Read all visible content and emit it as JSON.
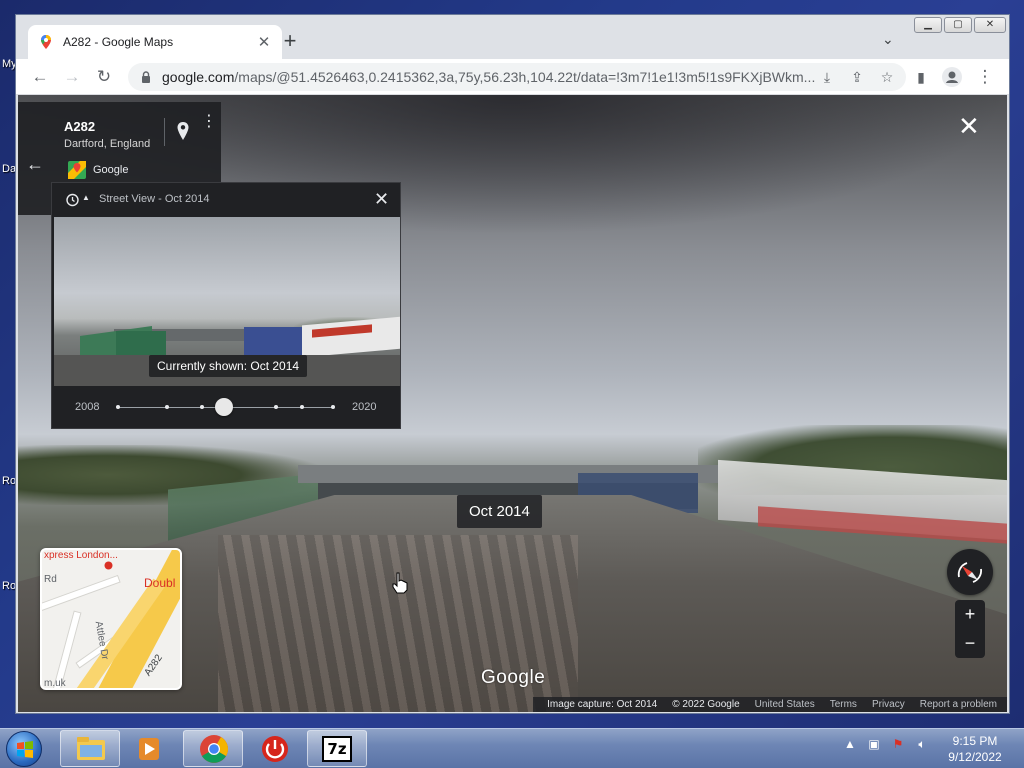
{
  "desktop": {
    "labels": [
      "My",
      "Da",
      "Ro",
      "Ro"
    ]
  },
  "browser": {
    "tab_title": "A282 - Google Maps",
    "new_tab_symbol": "+",
    "url_main": "google.com",
    "url_rest": "/maps/@51.4526463,0.2415362,3a,75y,56.23h,104.22t/data=!3m7!1e1!3m5!1s9FKXjBWkm..."
  },
  "place_card": {
    "road": "A282",
    "locality": "Dartford, England",
    "provider": "Google"
  },
  "time_machine": {
    "header": "Street View - Oct 2014",
    "tooltip": "Currently shown: Oct 2014",
    "year_start": "2008",
    "year_end": "2020"
  },
  "viewer": {
    "date_badge": "Oct 2014",
    "watermark": "Google",
    "zoom_in": "+",
    "zoom_out": "−"
  },
  "minimap": {
    "label_top": "xpress London...",
    "label_red": "Doubl",
    "label_rd": "Rd",
    "label_attlee": "Attlee Dr",
    "label_a282": "A282",
    "label_uk": "m.uk"
  },
  "footer": {
    "capture": "Image capture: Oct 2014",
    "copyright": "© 2022 Google",
    "region": "United States",
    "terms": "Terms",
    "privacy": "Privacy",
    "report": "Report a problem"
  },
  "taskbar": {
    "time": "9:15 PM",
    "date": "9/12/2022",
    "sevenzip_label": "7z"
  },
  "colors": {
    "chrome_frame": "#dee1e6",
    "panel_dark": "#202124",
    "taskbar": "#6e86b5",
    "accent_red": "#d93025"
  }
}
